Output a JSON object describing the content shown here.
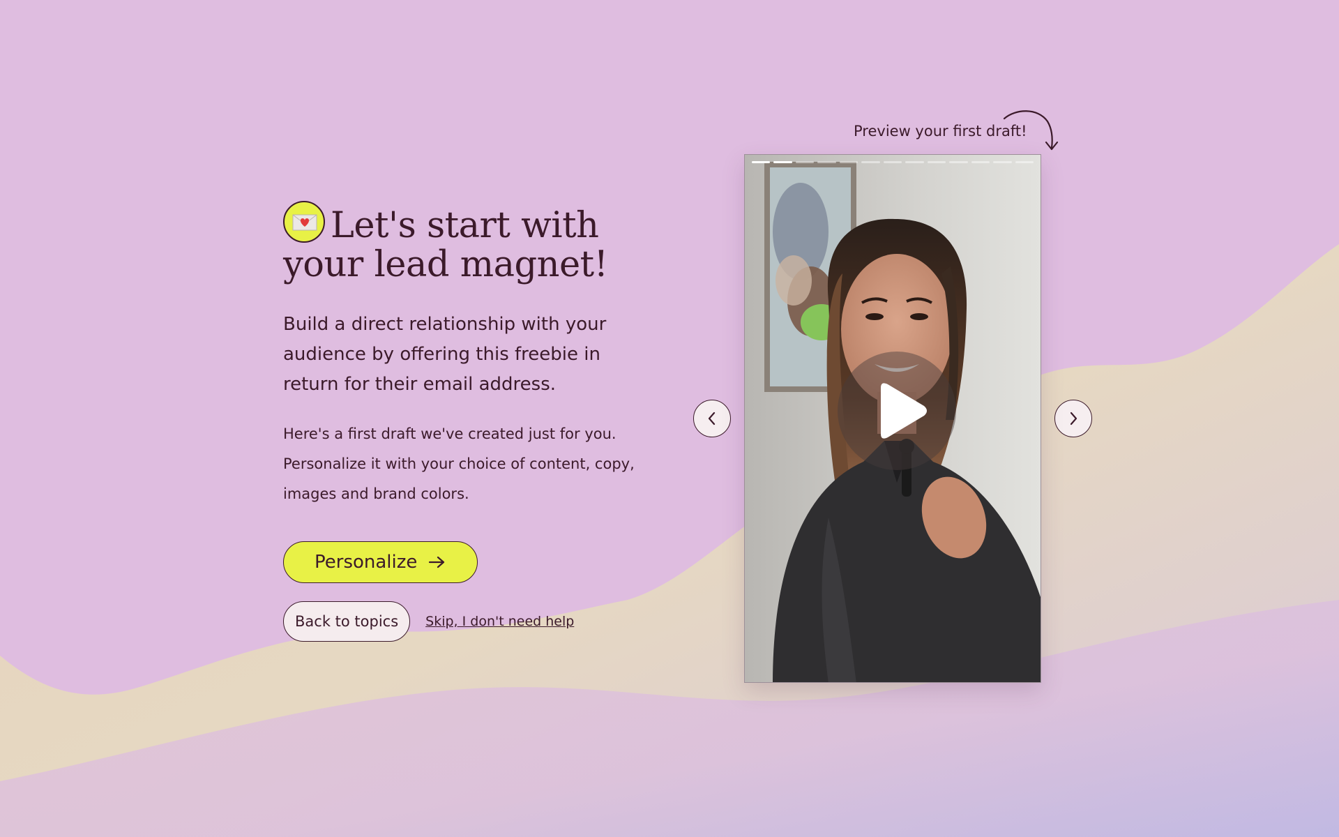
{
  "headline": {
    "line1": "Let's start with",
    "line2": "your lead magnet!",
    "emoji_icon": "love-letter-icon"
  },
  "lead_text": "Build a direct relationship with your audience by offering this freebie in return for their email address.",
  "sub_text": "Here's a first draft we've created just for you. Personalize it with your choice of content, copy, images and brand colors.",
  "buttons": {
    "personalize": "Personalize",
    "personalize_icon": "arrow-right-icon",
    "back": "Back to topics",
    "skip": "Skip, I don't need help"
  },
  "preview": {
    "label": "Preview your first draft!",
    "label_icon": "curved-arrow-icon",
    "progress_total": 13,
    "progress_done": 2,
    "play_icon": "play-icon",
    "prev_icon": "chevron-left-icon",
    "next_icon": "chevron-right-icon"
  },
  "colors": {
    "background": "#dfbde0",
    "accent_yellow": "#e8f146",
    "text": "#3b1a2a",
    "wave": "#e6d6b8"
  }
}
